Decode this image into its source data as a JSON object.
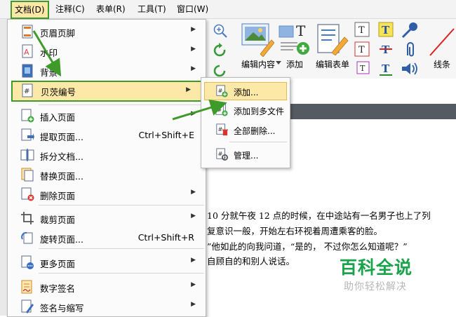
{
  "menubar": {
    "items": [
      {
        "label": "文档(D)",
        "x": 0
      },
      {
        "label": "注释(C)",
        "x": 0
      },
      {
        "label": "表单(R)",
        "x": 0
      },
      {
        "label": "工具(T)",
        "x": 0
      },
      {
        "label": "窗口(W)",
        "x": 0
      }
    ]
  },
  "toolbar": {
    "edit_content_label": "编辑内容",
    "add_label": "添加",
    "edit_form_label": "编辑表单",
    "lines_label": "线条"
  },
  "doc_menu": {
    "items": [
      {
        "label": "页眉页脚",
        "shortcut": "",
        "icon": "header-footer-icon"
      },
      {
        "label": "水印",
        "shortcut": "",
        "icon": "watermark-icon"
      },
      {
        "label": "背景",
        "shortcut": "",
        "icon": "background-icon"
      },
      {
        "label": "贝茨编号",
        "shortcut": "",
        "icon": "bates-number-icon"
      },
      {
        "label": "插入页面",
        "shortcut": "",
        "icon": "insert-page-icon"
      },
      {
        "label": "提取页面...",
        "shortcut": "Ctrl+Shift+E",
        "icon": "extract-page-icon"
      },
      {
        "label": "拆分文档...",
        "shortcut": "",
        "icon": "split-document-icon"
      },
      {
        "label": "替换页面...",
        "shortcut": "",
        "icon": "replace-page-icon"
      },
      {
        "label": "删除页面",
        "shortcut": "",
        "icon": "delete-page-icon"
      },
      {
        "label": "裁剪页面",
        "shortcut": "",
        "icon": "crop-page-icon"
      },
      {
        "label": "旋转页面...",
        "shortcut": "Ctrl+Shift+R",
        "icon": "rotate-page-icon"
      },
      {
        "label": "更多页面",
        "shortcut": "",
        "icon": "more-pages-icon"
      },
      {
        "label": "数字签名",
        "shortcut": "",
        "icon": "digital-signature-icon"
      },
      {
        "label": "签名与缩写",
        "shortcut": "",
        "icon": "sign-initials-icon"
      }
    ]
  },
  "bates_submenu": {
    "items": [
      {
        "label": "添加...",
        "icon": "bates-add-icon"
      },
      {
        "label": "添加到多文件",
        "icon": "bates-add-multiple-icon"
      },
      {
        "label": "全部删除...",
        "icon": "bates-remove-all-icon"
      },
      {
        "label": "管理...",
        "icon": "bates-manage-icon"
      }
    ]
  },
  "document_text": {
    "lines": [
      "10 分就午夜 12 点的时候，在中途站有一名男子也上了列",
      "复意识一般，开始左右环视着周遭乘客的脸。",
      "”他如此的向我问道，“是的，  不过你怎么知道呢？”",
      "自顾自的和别人说话。"
    ]
  },
  "watermark": {
    "title": "百科全说",
    "subtitle": "助你轻松解决"
  },
  "colors": {
    "highlight": "#fce8a7",
    "callout_green": "#3e9b2a",
    "watermark_green": "#1aa34a"
  }
}
